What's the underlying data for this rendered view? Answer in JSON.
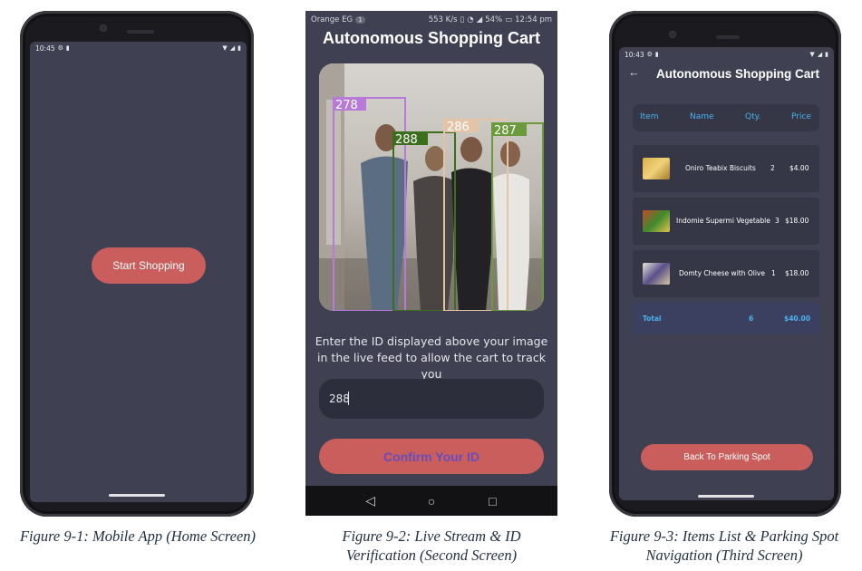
{
  "screen1": {
    "status_time": "10:45",
    "start_button": "Start Shopping",
    "caption": "Figure 9-1: Mobile App (Home Screen)"
  },
  "screen2": {
    "carrier": "Orange EG",
    "carrier_badge": "1",
    "status_right": "553 K/s",
    "battery": "54%",
    "clock": "12:54 pm",
    "title": "Autonomous Shopping Cart",
    "detections": [
      {
        "id": "278",
        "color": "#b87ad9"
      },
      {
        "id": "288",
        "color": "#3b6f1d"
      },
      {
        "id": "286",
        "color": "#e3c4a6"
      },
      {
        "id": "287",
        "color": "#6b9a3c"
      }
    ],
    "instruction": "Enter the ID displayed above your image in the live feed to allow the cart to track you",
    "id_value": "288",
    "confirm_button": "Confirm Your ID",
    "caption_line1": "Figure 9-2: Live Stream & ID",
    "caption_line2": "Verification (Second Screen)"
  },
  "screen3": {
    "status_time": "10:43",
    "title": "Autonomous Shopping Cart",
    "columns": [
      "Item",
      "Name",
      "Qty.",
      "Price"
    ],
    "items": [
      {
        "name": "Oniro Teabix Biscuits",
        "qty": "2",
        "price": "$4.00"
      },
      {
        "name": "Indomie Supermi Vegetable",
        "qty": "3",
        "price": "$18.00"
      },
      {
        "name": "Domty Cheese with Olive",
        "qty": "1",
        "price": "$18.00"
      }
    ],
    "total_label": "Total",
    "total_qty": "6",
    "total_price": "$40.00",
    "parking_button": "Back To Parking Spot",
    "caption_line1": "Figure 9-3: Items List & Parking Spot",
    "caption_line2": "Navigation (Third Screen)"
  },
  "colors": {
    "screen_bg": "#3f4052",
    "button": "#c95e5d",
    "accent_blue": "#4bb3f0"
  }
}
